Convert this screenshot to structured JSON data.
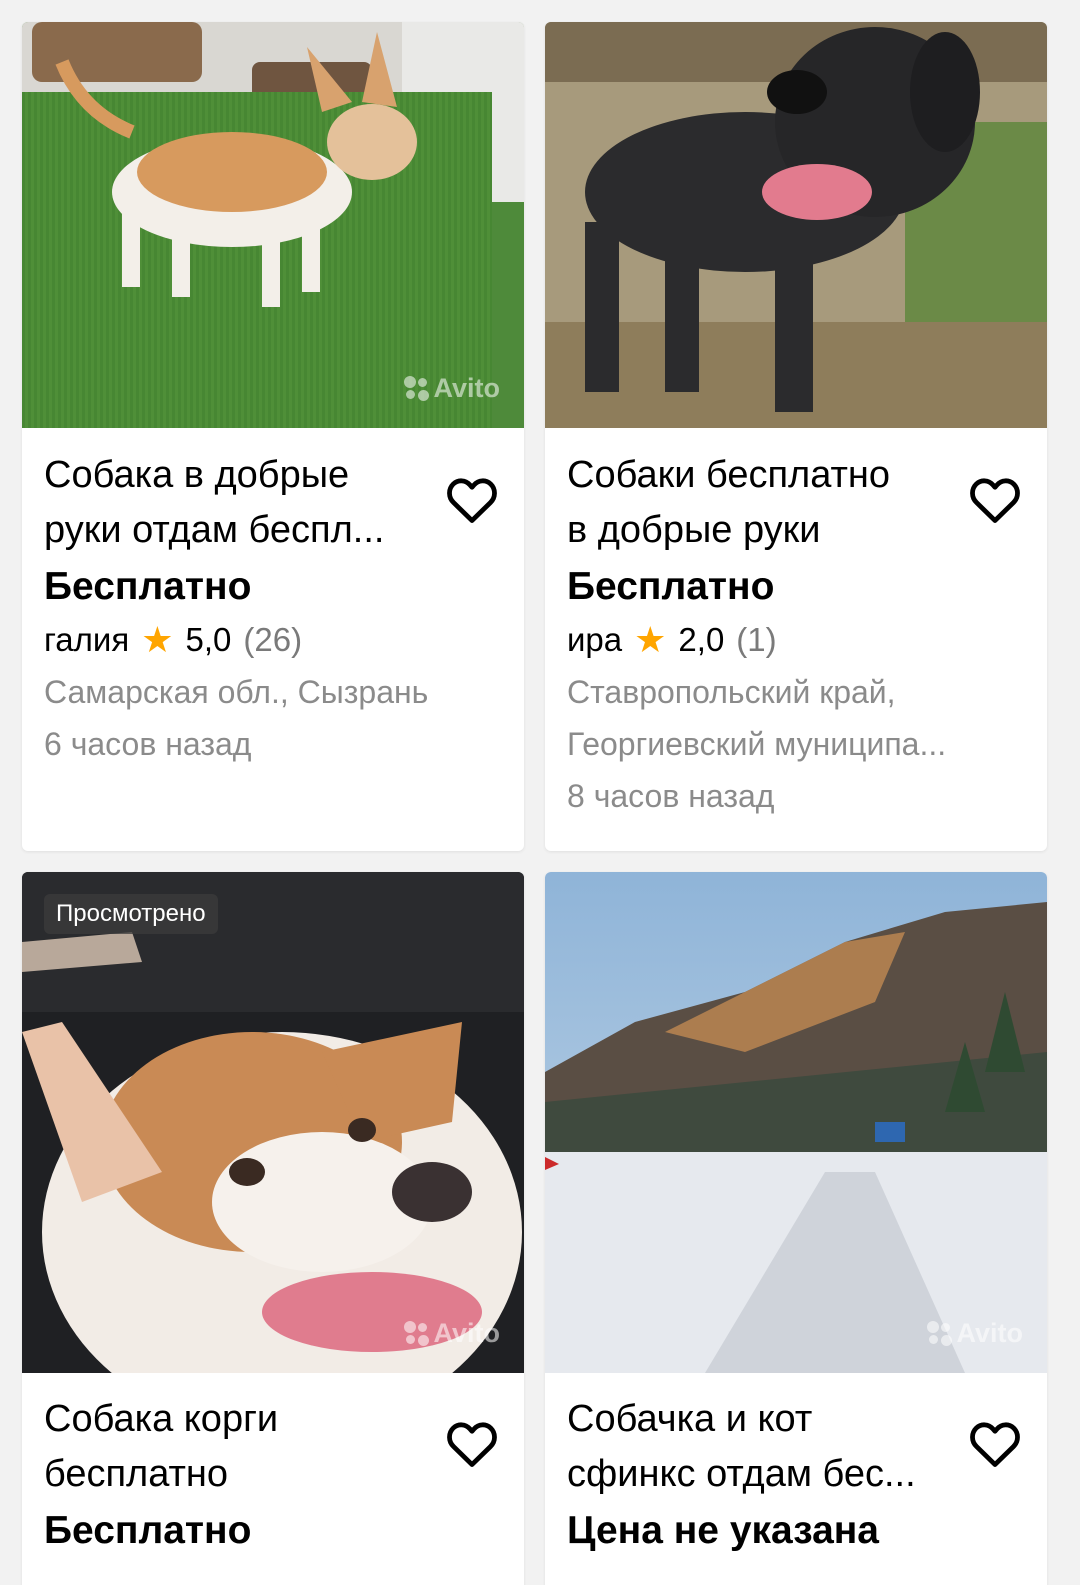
{
  "listings": [
    {
      "title_line1": "Собака в добрые",
      "title_line2": "руки отдам беспл...",
      "price": "Бесплатно",
      "seller": "галия",
      "rating": "5,0",
      "reviews": "(26)",
      "location_line1": "Самарская обл., Сызрань",
      "location_line2": "",
      "time": "6 часов назад",
      "watermark": "Avito",
      "badge": ""
    },
    {
      "title_line1": "Собаки бесплатно",
      "title_line2": "в добрые руки",
      "price": "Бесплатно",
      "seller": "ира",
      "rating": "2,0",
      "reviews": "(1)",
      "location_line1": "Ставропольский край,",
      "location_line2": "Георгиевский муниципа...",
      "time": "8 часов назад",
      "watermark": "",
      "badge": ""
    },
    {
      "title_line1": "Собака корги",
      "title_line2": "бесплатно",
      "price": "Бесплатно",
      "watermark": "Avito",
      "badge": "Просмотрено"
    },
    {
      "title_line1": "Собачка и кот",
      "title_line2": "сфинкс отдам бес...",
      "price": "Цена не указана",
      "watermark": "Avito",
      "badge": ""
    }
  ],
  "icons": {
    "favorite": "heart-outline-icon",
    "rating": "star-icon"
  },
  "colors": {
    "star": "#ffa500",
    "secondary_text": "#8b8b8b",
    "background": "#f2f2f2"
  }
}
